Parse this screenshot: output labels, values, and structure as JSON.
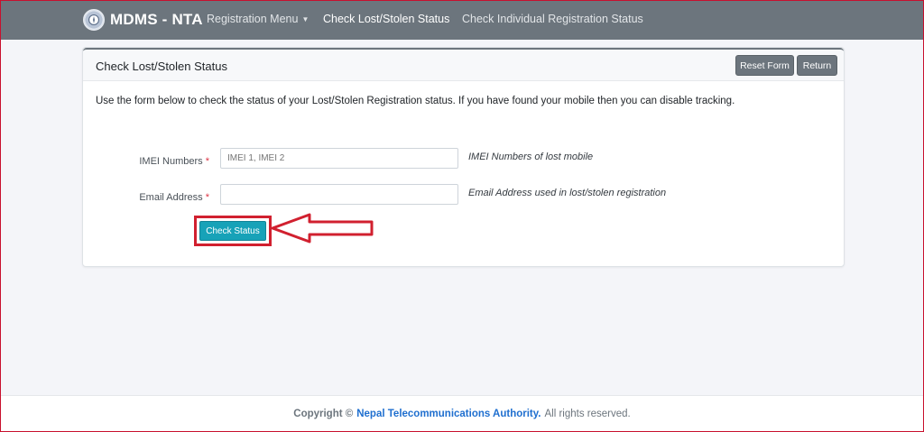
{
  "navbar": {
    "brand": "MDMS - NTA",
    "items": [
      {
        "label": "Registration Menu",
        "has_caret": true
      },
      {
        "label": "Check Lost/Stolen Status",
        "active": true
      },
      {
        "label": "Check Individual Registration Status"
      }
    ]
  },
  "card": {
    "title": "Check Lost/Stolen Status",
    "reset_label": "Reset Form",
    "return_label": "Return",
    "intro": "Use the form below to check the status of your Lost/Stolen Registration status. If you have found your mobile then you can disable tracking."
  },
  "form": {
    "imei": {
      "label": "IMEI Numbers",
      "required_mark": "*",
      "placeholder": "IMEI 1, IMEI 2",
      "value": "",
      "help": "IMEI Numbers of lost mobile"
    },
    "email": {
      "label": "Email Address",
      "required_mark": "*",
      "placeholder": "",
      "value": "",
      "help": "Email Address used in lost/stolen registration"
    },
    "submit_label": "Check Status"
  },
  "footer": {
    "prefix": "Copyright ©",
    "org": "Nepal Telecommunications Authority.",
    "suffix": "All rights reserved."
  },
  "colors": {
    "navbar": "#6c757d",
    "primary_button": "#17a2b8",
    "highlight": "#d1202f",
    "link": "#1f6fcf"
  }
}
